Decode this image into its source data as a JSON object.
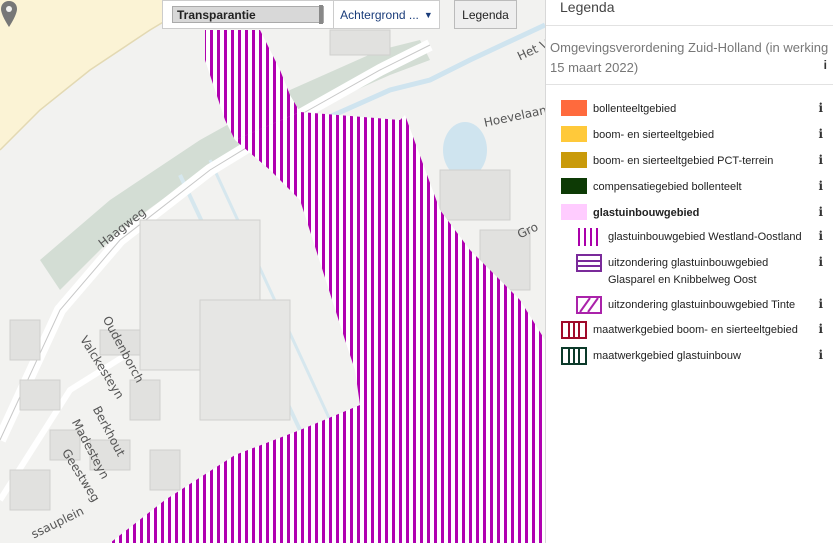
{
  "toolbar": {
    "transparency_label": "Transparantie",
    "background_label": "Achtergrond ...",
    "legend_button": "Legenda"
  },
  "map": {
    "street_labels": [
      "Het V",
      "Hoevelaan",
      "Haagweg",
      "Oudenborch",
      "Valckesteyn",
      "Berkhout",
      "Madesteyn",
      "Geestweg",
      "ssauplein",
      "Gro"
    ],
    "marker_icon": "map-pin-icon"
  },
  "panel": {
    "title": "Legenda",
    "subtitle_line1": "Omgevingsverordening Zuid-Holland (in werking per",
    "subtitle_line2": "15 maart 2022)",
    "info_glyph": "i",
    "items": [
      {
        "label": "bollenteeltgebied",
        "swatch": "solid",
        "color": "#ff6a3d"
      },
      {
        "label": "boom- en sierteeltgebied",
        "swatch": "solid",
        "color": "#ffc93a"
      },
      {
        "label": "boom- en sierteeltgebied PCT-terrein",
        "swatch": "solid",
        "color": "#c99a0a"
      },
      {
        "label": "compensatiegebied bollenteelt",
        "swatch": "solid",
        "color": "#0d3a05"
      },
      {
        "label": "glastuinbouwgebied",
        "swatch": "solid",
        "color": "#ffccff"
      },
      {
        "label": "glastuinbouwgebied Westland-Oostland",
        "swatch": "vertical-lines",
        "color": "#aa00aa"
      },
      {
        "label": "uitzondering glastuinbouwgebied",
        "label2": "Glasparel en Knibbelweg Oost",
        "swatch": "horizontal-box",
        "color": "#7a2a9a"
      },
      {
        "label": "uitzondering glastuinbouwgebied Tinte",
        "swatch": "diagonal-box",
        "color": "#aa22aa"
      },
      {
        "label": "maatwerkgebied boom- en sierteeltgebied",
        "swatch": "vertical-box",
        "color": "#a00a2a"
      },
      {
        "label": "maatwerkgebied glastuinbouw",
        "swatch": "vertical-box",
        "color": "#0c3a2a"
      }
    ]
  }
}
